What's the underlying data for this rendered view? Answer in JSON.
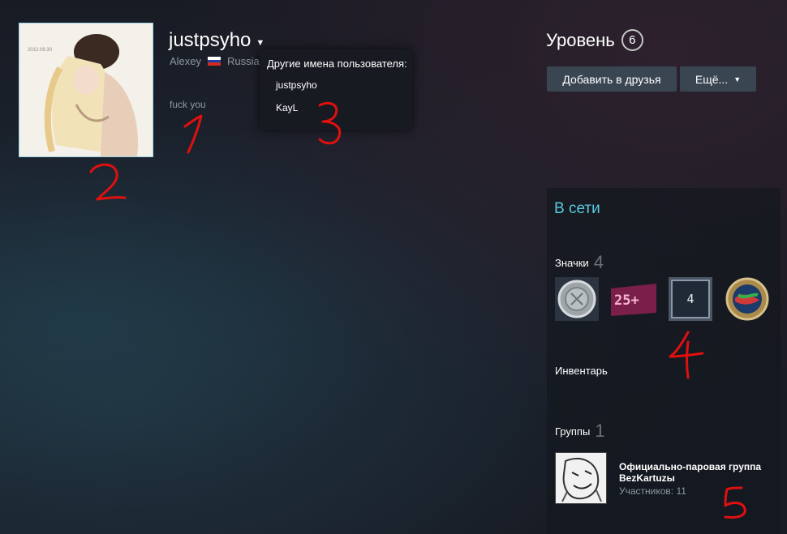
{
  "profile": {
    "persona_name": "justpsyho",
    "real_name": "Alexey",
    "country": "Russian",
    "summary": "fuck you"
  },
  "aliases_dropdown": {
    "title": "Другие имена пользователя:",
    "items": [
      "justpsyho",
      "KayL"
    ]
  },
  "level": {
    "label": "Уровень",
    "value": "6"
  },
  "actions": {
    "add_friend": "Добавить в друзья",
    "more": "Ещё..."
  },
  "sidebar": {
    "status": "В сети",
    "badges_label": "Значки",
    "badges_count": "4",
    "badges": [
      {
        "icon": "silver-coin-badge-icon"
      },
      {
        "icon": "25-plus-badge-icon",
        "text": "25+"
      },
      {
        "icon": "years-of-service-badge-icon",
        "text": "4"
      },
      {
        "icon": "globe-badge-icon"
      }
    ],
    "inventory_label": "Инвентарь",
    "groups_label": "Группы",
    "groups_count": "1",
    "group": {
      "name": "Официально-паровая группа BezKartuzы",
      "members": "Участников: 11"
    }
  },
  "annotations": [
    "1",
    "2",
    "3",
    "4",
    "5"
  ],
  "colors": {
    "online": "#57cbde",
    "button_bg": "#3a4552",
    "annotation": "#e01010"
  }
}
